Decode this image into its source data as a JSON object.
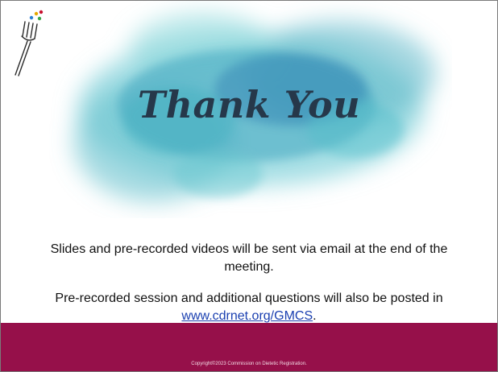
{
  "slide": {
    "title": "Thank You",
    "line1": "Slides and pre-recorded videos will be sent via email at the end of the meeting.",
    "line2_prefix": "Pre-recorded session and additional questions will also be posted in ",
    "link_text": "www.cdrnet.org/GMCS",
    "line2_suffix": ".",
    "copyright": "Copyright©2023 Commission on Dietetic Registration."
  },
  "icons": {
    "logo": "fork-icon",
    "background": "watercolor-splash"
  },
  "colors": {
    "footer": "#96104a",
    "title": "#26384a",
    "watercolor": "#4fb8c6",
    "link": "#1a3fb0"
  }
}
